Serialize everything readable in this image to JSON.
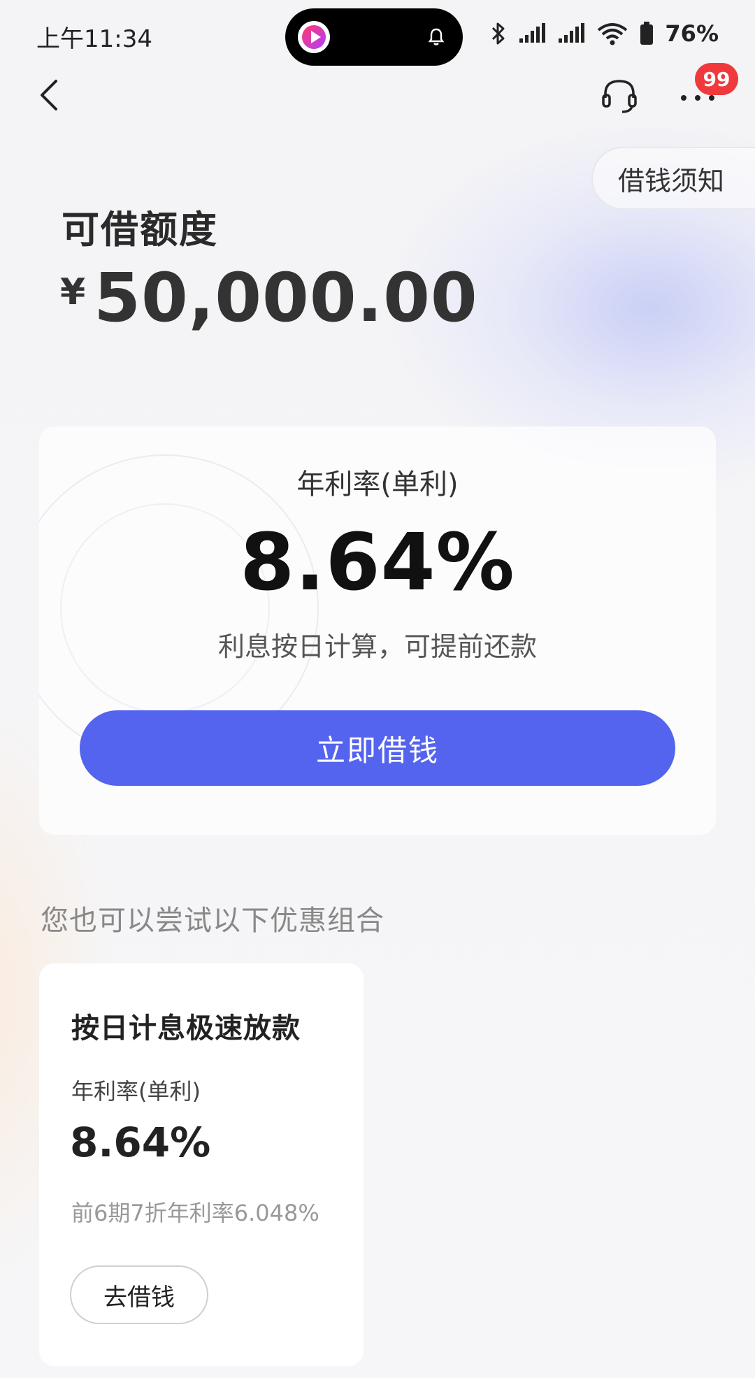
{
  "status_bar": {
    "time": "上午11:34",
    "battery": "76%"
  },
  "nav": {
    "badge_count": "99",
    "notice_label": "借钱须知"
  },
  "credit": {
    "label": "可借额度",
    "currency": "¥",
    "amount": "50,000.00"
  },
  "rate_card": {
    "rate_label": "年利率(单利)",
    "rate_value": "8.64%",
    "note": "利息按日计算，可提前还款",
    "button_label": "立即借钱"
  },
  "suggestions": {
    "label": "您也可以尝试以下优惠组合"
  },
  "offer": {
    "title": "按日计息极速放款",
    "rate_label": "年利率(单利)",
    "rate_value": "8.64%",
    "discount_text": "前6期7折年利率6.048%",
    "button_label": "去借钱"
  },
  "colors": {
    "primary_button": "#5464ee",
    "badge": "#f0393c"
  }
}
